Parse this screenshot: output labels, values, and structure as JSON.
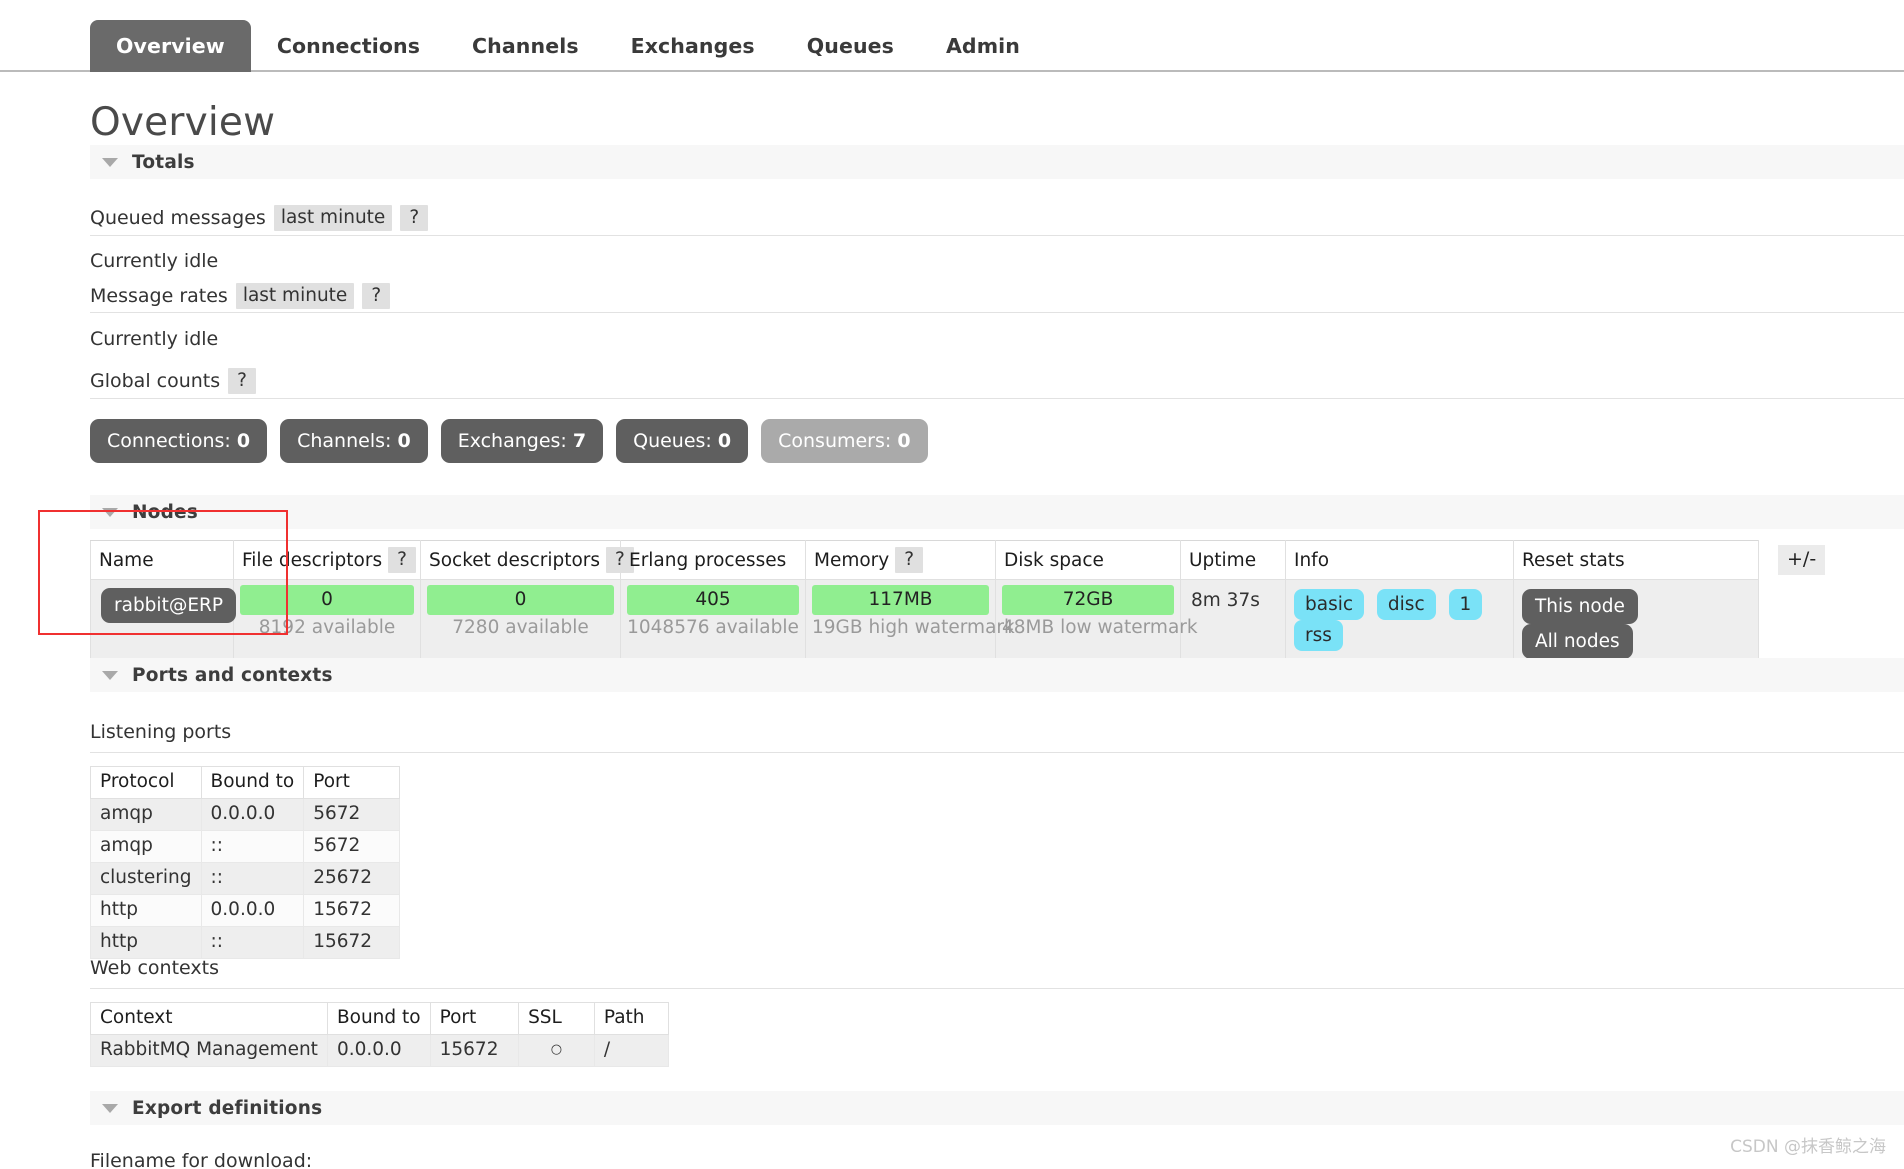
{
  "nav": {
    "items": [
      {
        "label": "Overview",
        "active": true
      },
      {
        "label": "Connections",
        "active": false
      },
      {
        "label": "Channels",
        "active": false
      },
      {
        "label": "Exchanges",
        "active": false
      },
      {
        "label": "Queues",
        "active": false
      },
      {
        "label": "Admin",
        "active": false
      }
    ]
  },
  "page": {
    "title": "Overview"
  },
  "sections": {
    "totals": "Totals",
    "nodes": "Nodes",
    "ports_and_contexts": "Ports and contexts",
    "export_definitions": "Export definitions"
  },
  "totals": {
    "queued_messages_label": "Queued messages",
    "queued_messages_period": "last minute",
    "queued_messages_help": "?",
    "queued_messages_status": "Currently idle",
    "message_rates_label": "Message rates",
    "message_rates_period": "last minute",
    "message_rates_help": "?",
    "message_rates_status": "Currently idle",
    "global_counts_label": "Global counts",
    "global_counts_help": "?",
    "counts": [
      {
        "label": "Connections:",
        "value": "0",
        "muted": false
      },
      {
        "label": "Channels:",
        "value": "0",
        "muted": false
      },
      {
        "label": "Exchanges:",
        "value": "7",
        "muted": false
      },
      {
        "label": "Queues:",
        "value": "0",
        "muted": false
      },
      {
        "label": "Consumers:",
        "value": "0",
        "muted": true
      }
    ]
  },
  "nodes": {
    "headers": {
      "name": "Name",
      "file_descriptors": "File descriptors",
      "file_descriptors_help": "?",
      "socket_descriptors": "Socket descriptors",
      "socket_descriptors_help": "?",
      "erlang_processes": "Erlang processes",
      "memory": "Memory",
      "memory_help": "?",
      "disk_space": "Disk space",
      "uptime": "Uptime",
      "info": "Info",
      "reset_stats": "Reset stats"
    },
    "plus_minus": "+/-",
    "row": {
      "name": "rabbit@ERP",
      "file_descriptors_value": "0",
      "file_descriptors_sub": "8192 available",
      "socket_descriptors_value": "0",
      "socket_descriptors_sub": "7280 available",
      "erlang_processes_value": "405",
      "erlang_processes_sub": "1048576 available",
      "memory_value": "117MB",
      "memory_sub": "19GB high watermark",
      "disk_space_value": "72GB",
      "disk_space_sub": "48MB low watermark",
      "uptime": "8m 37s",
      "info_pills": [
        "basic",
        "disc",
        "1",
        "rss"
      ],
      "reset_buttons": [
        "This node",
        "All nodes"
      ]
    }
  },
  "ports": {
    "listening_ports_label": "Listening ports",
    "listening_headers": [
      "Protocol",
      "Bound to",
      "Port"
    ],
    "listening_rows": [
      [
        "amqp",
        "0.0.0.0",
        "5672"
      ],
      [
        "amqp",
        "::",
        "5672"
      ],
      [
        "clustering",
        "::",
        "25672"
      ],
      [
        "http",
        "0.0.0.0",
        "15672"
      ],
      [
        "http",
        "::",
        "15672"
      ]
    ],
    "web_contexts_label": "Web contexts",
    "web_headers": [
      "Context",
      "Bound to",
      "Port",
      "SSL",
      "Path"
    ],
    "web_rows": [
      [
        "RabbitMQ Management",
        "0.0.0.0",
        "15672",
        "○",
        "/"
      ]
    ]
  },
  "export": {
    "filename_label": "Filename for download:"
  },
  "watermark": "CSDN @抹香鲸之海",
  "colors": {
    "accent_dark": "#5f5f5f",
    "gauge_green": "#90ee90",
    "info_blue": "#7ae2f7",
    "muted_gray": "#aaaaaa",
    "annotation_red": "#f03030"
  }
}
